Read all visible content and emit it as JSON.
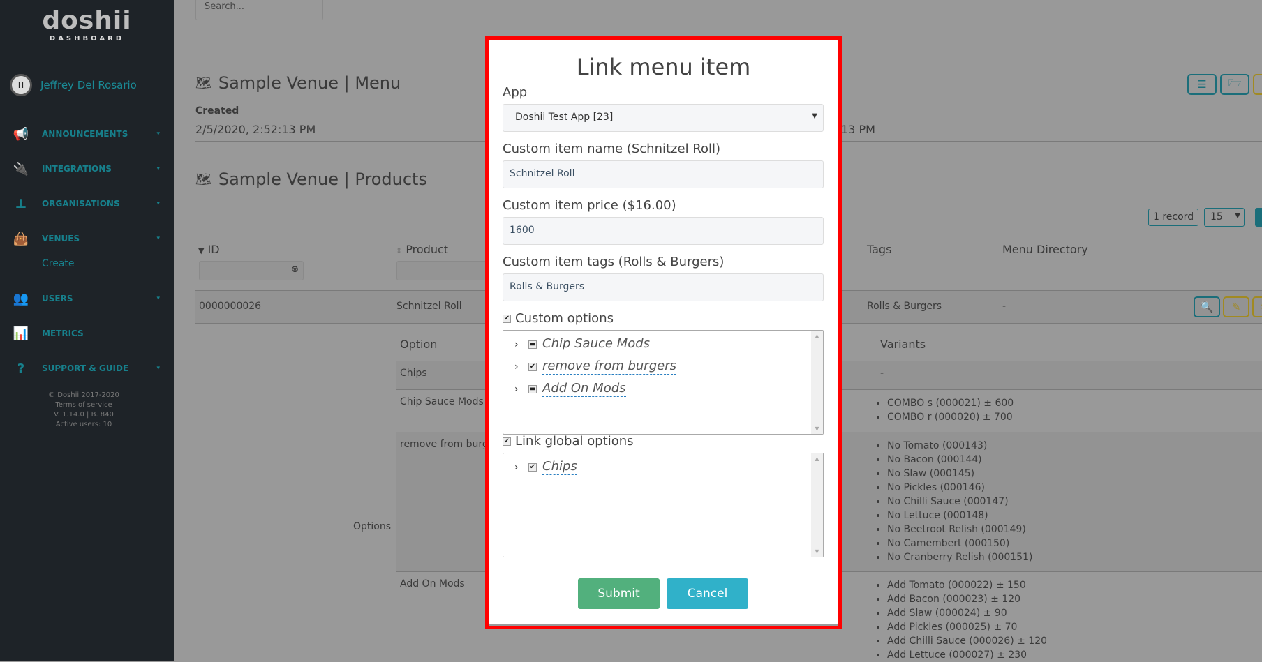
{
  "sidebar": {
    "logo": {
      "word": "doshii",
      "sub": "DASHBOARD",
      "mark": "<>"
    },
    "user": {
      "name": "Jeffrey Del Rosario",
      "avatar": "II"
    },
    "items": [
      {
        "label": "ANNOUNCEMENTS",
        "icon": "megaphone-icon",
        "glyph": "📢",
        "caret": "▾"
      },
      {
        "label": "INTEGRATIONS",
        "icon": "plug-icon",
        "glyph": "🔌",
        "caret": "▾"
      },
      {
        "label": "ORGANISATIONS",
        "icon": "sitemap-icon",
        "glyph": "⊥",
        "caret": "▾"
      },
      {
        "label": "VENUES",
        "icon": "shopping-bag-icon",
        "glyph": "👜",
        "caret": "▾"
      },
      {
        "label": "USERS",
        "icon": "users-icon",
        "glyph": "👥",
        "caret": "▾"
      },
      {
        "label": "METRICS",
        "icon": "bar-chart-icon",
        "glyph": "📊",
        "caret": ""
      },
      {
        "label": "SUPPORT & GUIDE",
        "icon": "question-circle-icon",
        "glyph": "?",
        "caret": "▾"
      }
    ],
    "venues_sub": "Create",
    "footer": [
      "© Doshii 2017-2020",
      "Terms of service",
      "V. 1.14.0 | B. 840",
      "Active users: 10"
    ]
  },
  "header": {
    "search_placeholder": "Search..."
  },
  "menu_section": {
    "title": "Sample Venue | Menu",
    "created_label": "Created",
    "created_value": "2/5/2020, 2:52:13 PM",
    "updated_fragment": "13 PM"
  },
  "products_section": {
    "title": "Sample Venue | Products",
    "records": "1 record",
    "page_size": "15",
    "columns": {
      "id": "ID",
      "product": "Product",
      "tags": "Tags",
      "menu_directory": "Menu Directory"
    },
    "row": {
      "id": "0000000026",
      "product": "Schnitzel Roll",
      "tags": "Rolls & Burgers",
      "menu_directory": "-"
    },
    "options_label": "Options",
    "options_table": {
      "headers": {
        "option": "Option",
        "variants": "Variants"
      },
      "rows": [
        {
          "option": "Chips",
          "variants": [
            "-"
          ]
        },
        {
          "option": "Chip Sauce Mods",
          "variants": [
            "COMBO s (000021) ± 600",
            "COMBO r (000020) ± 700"
          ]
        },
        {
          "option": "remove from burgers",
          "variants": [
            "No Tomato (000143)",
            "No Bacon (000144)",
            "No Slaw (000145)",
            "No Pickles (000146)",
            "No Chilli Sauce (000147)",
            "No Lettuce (000148)",
            "No Beetroot Relish (000149)",
            "No Camembert (000150)",
            "No Cranberry Relish (000151)"
          ]
        },
        {
          "option": "Add On Mods",
          "variants": [
            "Add Tomato (000022) ± 150",
            "Add Bacon (000023) ± 120",
            "Add Slaw (000024) ± 90",
            "Add Pickles (000025) ± 70",
            "Add Chilli Sauce (000026) ± 120",
            "Add Lettuce (000027) ± 230"
          ]
        }
      ]
    }
  },
  "modal": {
    "title": "Link menu item",
    "app_label": "App",
    "app_value": "Doshii Test App [23]",
    "name_label": "Custom item name (Schnitzel Roll)",
    "name_value": "Schnitzel Roll",
    "price_label": "Custom item price ($16.00)",
    "price_value": "1600",
    "tags_label": "Custom item tags (Rolls & Burgers)",
    "tags_value": "Rolls & Burgers",
    "custom_options_label": "Custom options",
    "custom_options_checked": true,
    "custom_options": [
      {
        "label": "Chip Sauce Mods",
        "state": "partial"
      },
      {
        "label": "remove from burgers",
        "state": "checked"
      },
      {
        "label": "Add On Mods",
        "state": "partial"
      }
    ],
    "global_options_label": "Link global options",
    "global_options_checked": true,
    "global_options": [
      {
        "label": "Chips",
        "state": "checked"
      }
    ],
    "submit_label": "Submit",
    "cancel_label": "Cancel"
  },
  "colors": {
    "sidebar_bg": "#1e2328",
    "accent": "#17808c",
    "submit": "#52b07d",
    "cancel": "#30b1c9",
    "highlight": "#ff0000"
  }
}
